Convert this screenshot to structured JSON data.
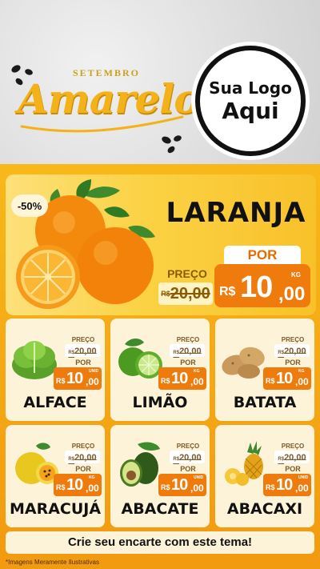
{
  "header": {
    "brand_small": "SETEMBRO",
    "brand_big": "Amarelo",
    "logo_line1": "Sua Logo",
    "logo_line2": "Aqui"
  },
  "featured": {
    "discount": "-50%",
    "title": "LARANJA",
    "was_label": "PREÇO",
    "was_currency": "R$",
    "was_value": "20,00",
    "now_label": "POR",
    "now_currency": "R$",
    "now_int": "10",
    "now_dec": ",00",
    "now_unit": "KG"
  },
  "products": [
    {
      "name": "ALFACE",
      "was_label": "PREÇO",
      "was_currency": "R$",
      "was_value": "20,00",
      "now_label": "POR",
      "now_currency": "R$",
      "now_int": "10",
      "now_dec": ",00",
      "unit": "UNID",
      "icon": "lettuce-icon"
    },
    {
      "name": "LIMÃO",
      "was_label": "PREÇO",
      "was_currency": "R$",
      "was_value": "20,00",
      "now_label": "POR",
      "now_currency": "R$",
      "now_int": "10",
      "now_dec": ",00",
      "unit": "KG",
      "icon": "lime-icon"
    },
    {
      "name": "BATATA",
      "was_label": "PREÇO",
      "was_currency": "R$",
      "was_value": "20,00",
      "now_label": "POR",
      "now_currency": "R$",
      "now_int": "10",
      "now_dec": ",00",
      "unit": "KG",
      "icon": "potato-icon"
    },
    {
      "name": "MARACUJÁ",
      "was_label": "PREÇO",
      "was_currency": "R$",
      "was_value": "20,00",
      "now_label": "POR",
      "now_currency": "R$",
      "now_int": "10",
      "now_dec": ",00",
      "unit": "KG",
      "icon": "passionfruit-icon"
    },
    {
      "name": "ABACATE",
      "was_label": "PREÇO",
      "was_currency": "R$",
      "was_value": "20,00",
      "now_label": "POR",
      "now_currency": "R$",
      "now_int": "10",
      "now_dec": ",00",
      "unit": "UNID",
      "icon": "avocado-icon"
    },
    {
      "name": "ABACAXI",
      "was_label": "PREÇO",
      "was_currency": "R$",
      "was_value": "20,00",
      "now_label": "POR",
      "now_currency": "R$",
      "now_int": "10",
      "now_dec": ",00",
      "unit": "UNID",
      "icon": "pineapple-icon"
    }
  ],
  "footer": {
    "cta": "Crie seu encarte com este tema!",
    "note": "*Imagens Meramente Ilustrativas"
  },
  "colors": {
    "background_orange": "#f8b81a",
    "price_orange": "#ef7b0c",
    "card_cream": "#fdf3d8",
    "brand_yellow": "#f3b21a"
  }
}
